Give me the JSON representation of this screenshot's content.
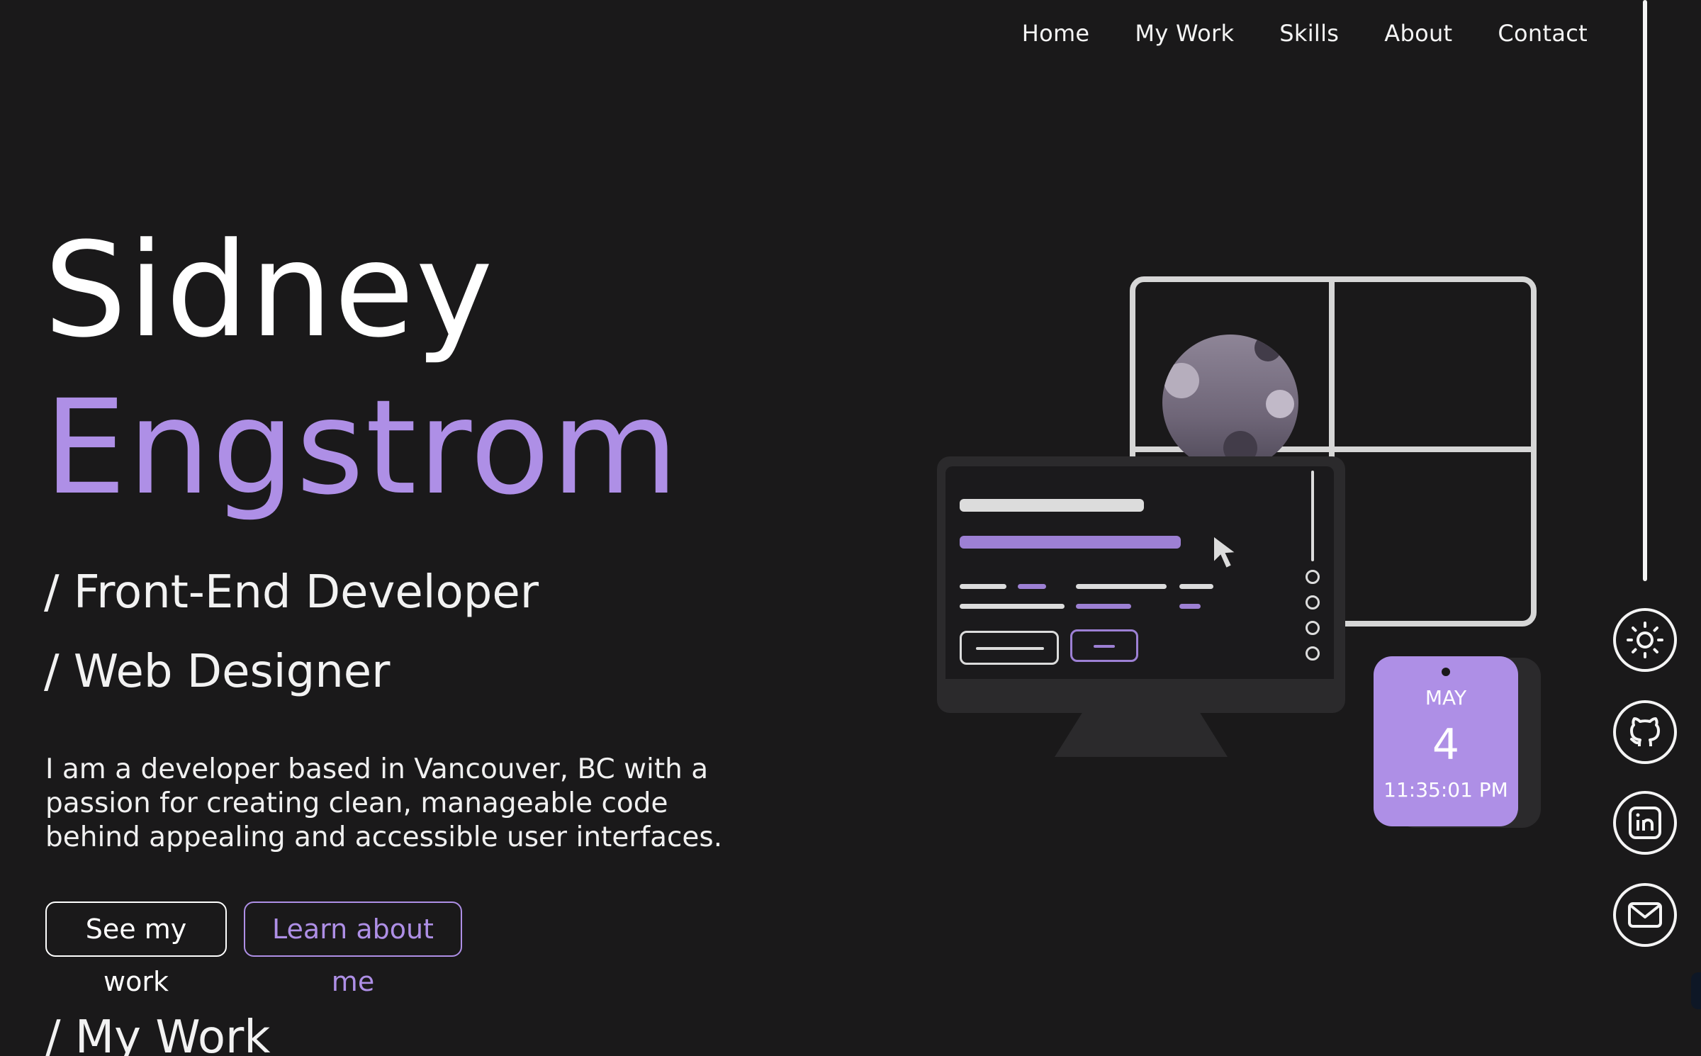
{
  "nav": {
    "items": [
      {
        "label": "Home"
      },
      {
        "label": "My Work"
      },
      {
        "label": "Skills"
      },
      {
        "label": "About"
      },
      {
        "label": "Contact"
      }
    ]
  },
  "hero": {
    "first_name": "Sidney",
    "last_name": "Engstrom",
    "roles": [
      "/ Front-End Developer",
      "/ Web Designer"
    ],
    "bio": "I am a developer based in Vancouver, BC with a passion for creating clean, manageable code behind appealing and accessible user interfaces.",
    "buttons": {
      "primary": "See my work",
      "secondary": "Learn about me"
    }
  },
  "illustration": {
    "calendar": {
      "month": "MAY",
      "day": "4",
      "time": "11:35:01 PM"
    }
  },
  "sections": {
    "my_work_title": "/ My Work"
  },
  "sidebar": {
    "icons": [
      "sun-icon",
      "github-icon",
      "linkedin-icon",
      "mail-icon"
    ]
  },
  "colors": {
    "background": "#1a191a",
    "accent": "#ae8fe6",
    "text": "#ffffff",
    "panel": "#2b2a2c"
  }
}
